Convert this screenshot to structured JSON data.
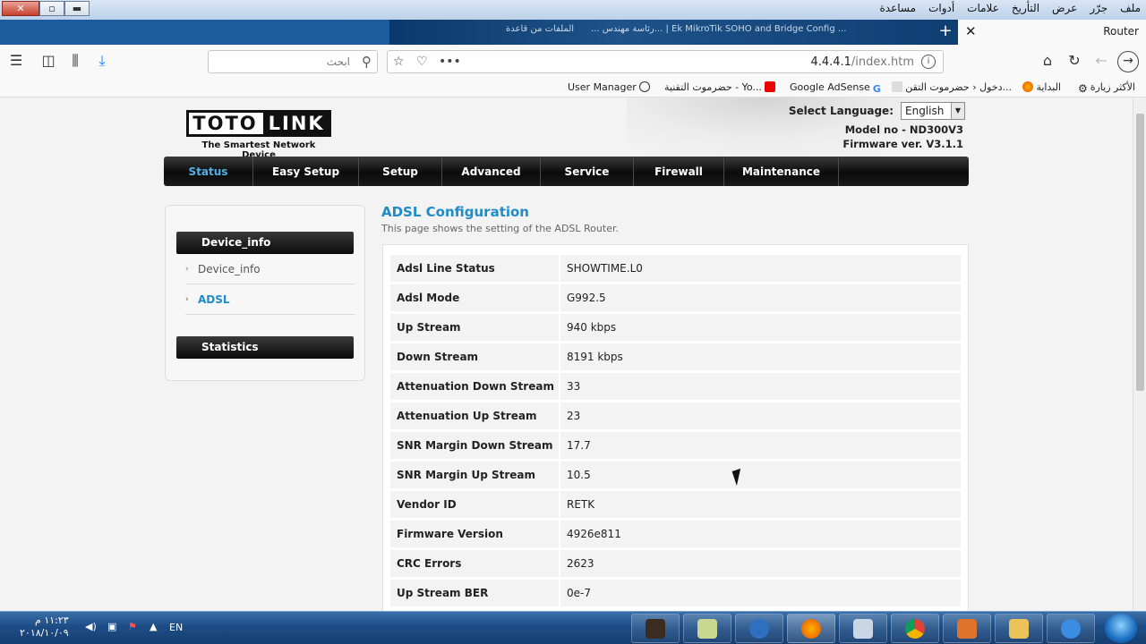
{
  "browser": {
    "menu": [
      "ملف",
      "جرّر",
      "عرض",
      "التأريخ",
      "علامات",
      "أدوات",
      "مساعدة"
    ],
    "active_tab_title": "Router",
    "background_tabs": [
      "... رئاسة مهندس... | Ek MikroTik SOHO and Bridge Config ...",
      "الملفات من قاعدة"
    ],
    "search_placeholder": "ابحث",
    "url_host": "4.4.4.1",
    "url_path": "/index.htm",
    "bookmarks": [
      "الأكثر زيارة",
      "البداية",
      "دخول ‹ حضرموت التقن...",
      "Google AdSense",
      "حضرموت التقنية - Yo...",
      "User Manager"
    ]
  },
  "router": {
    "brand_left": "TOTO",
    "brand_right": "LINK",
    "tagline": "The Smartest Network Device",
    "language_label": "Select Language:",
    "language_value": "English",
    "model": "Model no - ND300V3",
    "firmware": "Firmware ver. V3.1.1",
    "nav": [
      "Status",
      "Easy Setup",
      "Setup",
      "Advanced",
      "Service",
      "Firewall",
      "Maintenance"
    ],
    "nav_active": "Status",
    "sidebar": {
      "group1": "Device_info",
      "items": [
        "Device_info",
        "ADSL"
      ],
      "active_item": "ADSL",
      "group2": "Statistics"
    },
    "title": "ADSL Configuration",
    "subtitle": "This page shows the setting of the ADSL Router.",
    "rows": [
      {
        "k": "Adsl Line Status",
        "v": "SHOWTIME.L0"
      },
      {
        "k": "Adsl Mode",
        "v": "G992.5"
      },
      {
        "k": "Up Stream",
        "v": "940 kbps"
      },
      {
        "k": "Down Stream",
        "v": "8191 kbps"
      },
      {
        "k": "Attenuation Down Stream",
        "v": "33"
      },
      {
        "k": "Attenuation Up Stream",
        "v": "23"
      },
      {
        "k": "SNR Margin Down Stream",
        "v": "17.7"
      },
      {
        "k": "SNR Margin Up Stream",
        "v": "10.5"
      },
      {
        "k": "Vendor ID",
        "v": "RETK"
      },
      {
        "k": "Firmware Version",
        "v": "4926e811"
      },
      {
        "k": "CRC Errors",
        "v": "2623"
      },
      {
        "k": "Up Stream BER",
        "v": "0e-7"
      }
    ]
  },
  "taskbar": {
    "time": "١١:٢٣ م",
    "date": "٢٠١٨/١٠/٠٩",
    "lang": "EN"
  },
  "colors": {
    "accent": "#1e8cc8",
    "nav_active": "#4fb3e8",
    "taskbar": "#1d4d86"
  }
}
